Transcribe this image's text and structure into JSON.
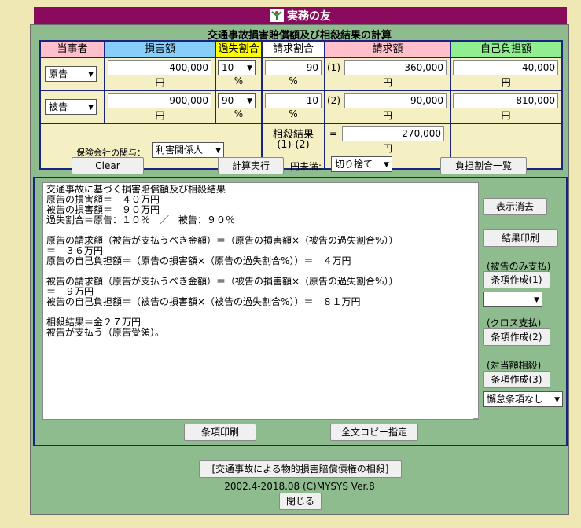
{
  "window": {
    "title": "実務の友"
  },
  "calc": {
    "title": "交通事故損害賠償額及び相殺結果の計算",
    "headers": {
      "party": "当事者",
      "damage": "損害額",
      "fault": "過失割合",
      "claim_ratio": "請求割合",
      "claim_amount": "請求額",
      "self_burden": "自己負担額"
    },
    "rows": [
      {
        "party": "原告",
        "damage": "400,000",
        "damage_unit": "円",
        "fault": "10",
        "fault_unit": "%",
        "claim_ratio": "90",
        "claim_ratio_unit": "%",
        "claim_tag": "(1)",
        "claim_amount": "360,000",
        "claim_unit": "円",
        "self_burden": "40,000",
        "self_unit": "円"
      },
      {
        "party": "被告",
        "damage": "900,000",
        "damage_unit": "円",
        "fault": "90",
        "fault_unit": "%",
        "claim_ratio": "10",
        "claim_ratio_unit": "%",
        "claim_tag": "(2)",
        "claim_amount": "90,000",
        "claim_unit": "円",
        "self_burden": "810,000",
        "self_unit": "円"
      }
    ],
    "insurance_label": "保険会社の関与：",
    "insurance_value": "利害関係人",
    "offset_label": "相殺結果",
    "offset_sub": "(1)-(2)",
    "offset_eq": "=",
    "offset_value": "270,000",
    "offset_unit": "円"
  },
  "toolbar": {
    "clear": "Clear",
    "calculate": "計算実行",
    "rounding_label": "円未満:",
    "rounding_value": "切り捨て",
    "burden_list": "負担割合一覧"
  },
  "result": {
    "text": "交通事故に基づく損害賠償額及び相殺結果\n原告の損害額＝　４０万円\n被告の損害額＝　９０万円\n過失割合＝原告：１０％　／　被告：９０％\n\n原告の請求額（被告が支払うべき金額）＝（原告の損害額×（被告の過失割合%））\n＝　３６万円\n原告の自己負担額＝（原告の損害額×（原告の過失割合%））＝　４万円\n\n被告の請求額（原告が支払うべき金額）＝（被告の損害額×（原告の過失割合%））\n＝　９万円\n被告の自己負担額＝（被告の損害額×（被告の過失割合%））＝　８１万円\n\n相殺結果＝金２７万円\n被告が支払う（原告受領）。"
  },
  "side": {
    "clear_display": "表示消去",
    "print_result": "結果印刷",
    "label_defendant_only": "(被告のみ支払)",
    "clause1": "条項作成(1)",
    "select1_value": "",
    "label_cross": "(クロス支払)",
    "clause2": "条項作成(2)",
    "label_offset": "(対当額相殺)",
    "clause3": "条項作成(3)",
    "select3_value": "懈怠条項なし"
  },
  "bottom": {
    "print_clause": "条項印刷",
    "copy_all": "全文コピー指定",
    "link": "[交通事故による物的損害賠償債権の相殺]",
    "copyright": "2002.4-2018.08 (C)MYSYS Ver.8",
    "close": "閉じる"
  }
}
